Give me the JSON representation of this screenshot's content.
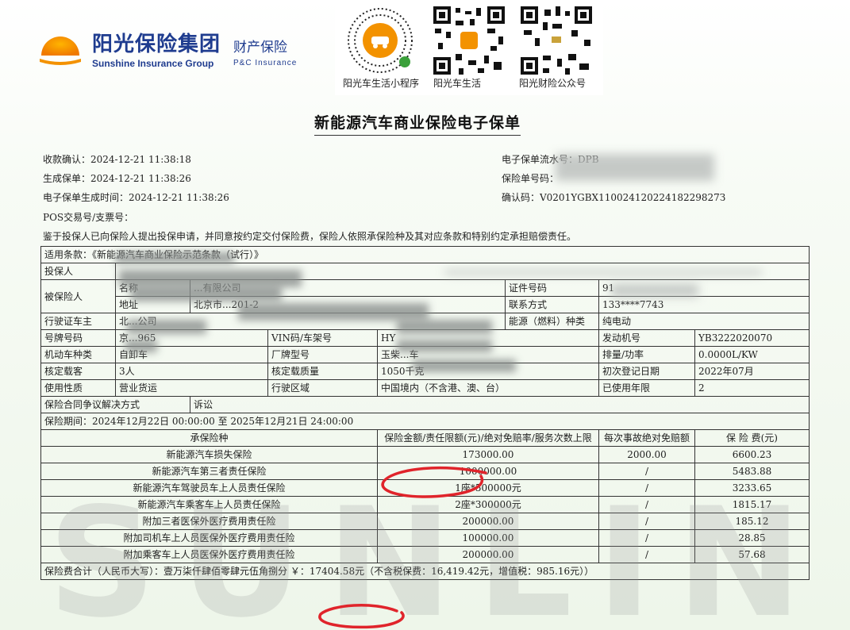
{
  "header": {
    "brand_cn": "阳光保险集团",
    "brand_cn_sub": "财产保险",
    "brand_en": "Sunshine Insurance Group",
    "brand_en_sub": "P&C Insurance",
    "qr_labels": [
      "阳光车生活小程序",
      "阳光车生活",
      "阳光财险公众号"
    ]
  },
  "title": "新能源汽车商业保险电子保单",
  "meta": {
    "left": [
      "收款确认：2024-12-21 11:38:18",
      "生成保单：2024-12-21 11:38:26",
      "电子保单生成时间：2024-12-21 11:38:26",
      "POS交易号/支票号："
    ],
    "right": [
      "电子保单流水号：DPB",
      "保险单号码：",
      "确认码：V0201YGBX11002412022418229827З"
    ],
    "notice": "鉴于投保人已向保险人提出投保申请，并同意按约定交付保险费，保险人依照承保险种及其对应条款和特别约定承担赔偿责任。"
  },
  "table": {
    "clause": "适用条款：《新能源汽车商业保险示范条款（试行）》",
    "applicant_label": "投保人",
    "insured_label": "被保险人",
    "name_label": "名称",
    "name_value": "...有限公司",
    "id_label": "证件号码",
    "id_value": "91",
    "address_label": "地址",
    "address_value": "北京市...201-2",
    "contact_label": "联系方式",
    "contact_value": "133****7743",
    "owner_label": "行驶证车主",
    "owner_value": "北...公司",
    "energy_label": "能源（燃料）种类",
    "energy_value": "纯电动",
    "plate_label": "号牌号码",
    "plate_value": "京...965",
    "vin_label": "VIN码/车架号",
    "vin_value": "HY",
    "engine_label": "发动机号",
    "engine_value": "YB3222020070",
    "vehicle_type_label": "机动车种类",
    "vehicle_type_value": "自卸车",
    "model_label": "厂牌型号",
    "model_value": "玉柴...车",
    "power_label": "排量/功率",
    "power_value": "0.0000L/KW",
    "seats_label": "核定载客",
    "seats_value": "3人",
    "load_label": "核定载质量",
    "load_value": "1050千克",
    "reg_date_label": "初次登记日期",
    "reg_date_value": "2022年07月",
    "usage_label": "使用性质",
    "usage_value": "营业货运",
    "area_label": "行驶区域",
    "area_value": "中国境内（不含港、澳、台）",
    "years_label": "已使用年限",
    "years_value": "2",
    "dispute_label": "保险合同争议解决方式",
    "dispute_value": "诉讼",
    "period": "保险期间：2024年12月22日 00:00:00 至 2025年12月21日 24:00:00",
    "col_headers": [
      "承保险种",
      "保险金额/责任限额(元)/绝对免赔率/服务次数上限",
      "每次事故绝对免赔额",
      "保  险  费(元)"
    ],
    "rows": [
      {
        "name": "新能源汽车损失保险",
        "amount": "173000.00",
        "deductible": "2000.00",
        "premium": "6600.23"
      },
      {
        "name": "新能源汽车第三者责任保险",
        "amount": "1000000.00",
        "deductible": "/",
        "premium": "5483.88"
      },
      {
        "name": "新能源汽车驾驶员车上人员责任保险",
        "amount": "1座*500000元",
        "deductible": "/",
        "premium": "3233.65"
      },
      {
        "name": "新能源汽车乘客车上人员责任保险",
        "amount": "2座*300000元",
        "deductible": "/",
        "premium": "1815.17"
      },
      {
        "name": "附加三者医保外医疗费用责任险",
        "amount": "200000.00",
        "deductible": "/",
        "premium": "185.12"
      },
      {
        "name": "附加司机车上人员医保外医疗费用责任险",
        "amount": "100000.00",
        "deductible": "/",
        "premium": "28.85"
      },
      {
        "name": "附加乘客车上人员医保外医疗费用责任险",
        "amount": "200000.00",
        "deductible": "/",
        "premium": "57.68"
      }
    ],
    "total": "保险费合计（人民币大写）：壹万柒仟肆佰零肆元伍角捌分 ￥：17404.58元（不含税保费：16,419.42元，增值税：985.16元））"
  },
  "watermark": "SUNLINE",
  "colors": {
    "brand_blue": "#1f3c8f",
    "brand_orange": "#f39200",
    "annotation_red": "#e0242b"
  }
}
